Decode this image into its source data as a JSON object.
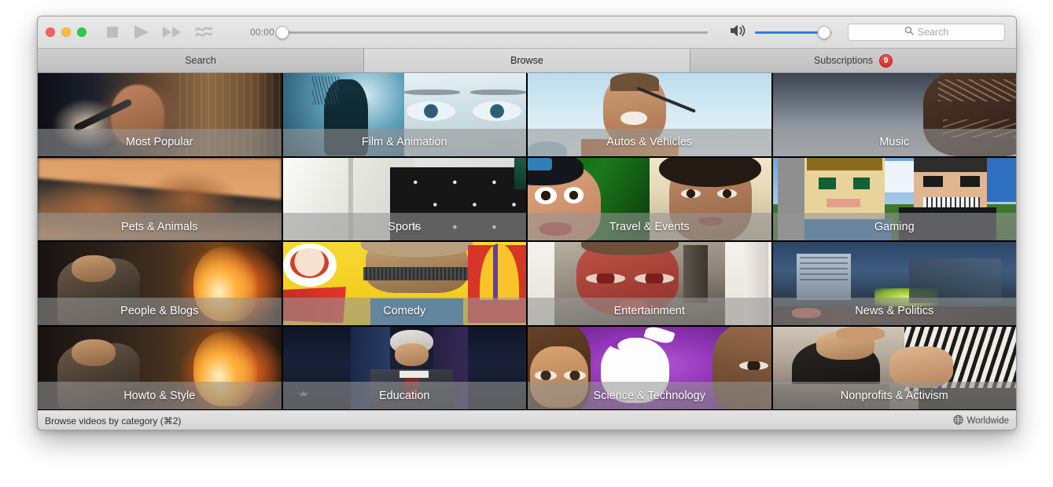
{
  "window": {
    "traffic_lights": [
      "close-red",
      "minimize-yellow",
      "maximize-green"
    ],
    "colors": {
      "accent_blue": "#2f7fe8",
      "badge_red": "#d62f2b",
      "chrome": "#dcdcdc",
      "tab_active": "#d8d8d8"
    }
  },
  "toolbar": {
    "stop_label": "stop-icon",
    "play_label": "play-icon",
    "fast_forward_label": "fast-forward-icon",
    "shuffle_label": "shuffle-waves-icon",
    "time_elapsed": "00:00",
    "progress_percent": 0,
    "volume_icon": "speaker-volume-icon",
    "volume_percent": 90,
    "search": {
      "value": "",
      "placeholder": "Search",
      "icon": "search-icon"
    }
  },
  "tabs": [
    {
      "label": "Search",
      "active": false,
      "badge": null
    },
    {
      "label": "Browse",
      "active": true,
      "badge": null
    },
    {
      "label": "Subscriptions",
      "active": false,
      "badge": "9"
    }
  ],
  "grid": {
    "columns": 4,
    "rows": 4,
    "tiles": [
      {
        "label": "Most Popular",
        "art": "stage-singer-microphone"
      },
      {
        "label": "Film & Animation",
        "art": "archer-and-blue-eyes"
      },
      {
        "label": "Autos & Vehicles",
        "art": "woman-shouting-sky"
      },
      {
        "label": "Music",
        "art": "tattooed-head-gray"
      },
      {
        "label": "Pets & Animals",
        "art": "orange-blur"
      },
      {
        "label": "Sports",
        "art": "white-tent-logo-wall"
      },
      {
        "label": "Travel & Events",
        "art": "cartoon-princess-and-portrait"
      },
      {
        "label": "Gaming",
        "art": "minecraft-blocky-faces"
      },
      {
        "label": "People & Blogs",
        "art": "man-with-fire"
      },
      {
        "label": "Comedy",
        "art": "blindfold-fastfood-logos"
      },
      {
        "label": "Entertainment",
        "art": "bloody-face-indoors"
      },
      {
        "label": "News & Politics",
        "art": "night-city-street"
      },
      {
        "label": "Howto & Style",
        "art": "man-with-fire"
      },
      {
        "label": "Education",
        "art": "speaker-at-podium"
      },
      {
        "label": "Science & Technology",
        "art": "apple-logo-purple-faces"
      },
      {
        "label": "Nonprofits & Activism",
        "art": "hands-holding-kitten"
      }
    ]
  },
  "statusbar": {
    "hint": "Browse videos by category (⌘2)",
    "region_icon": "globe-icon",
    "region": "Worldwide"
  }
}
